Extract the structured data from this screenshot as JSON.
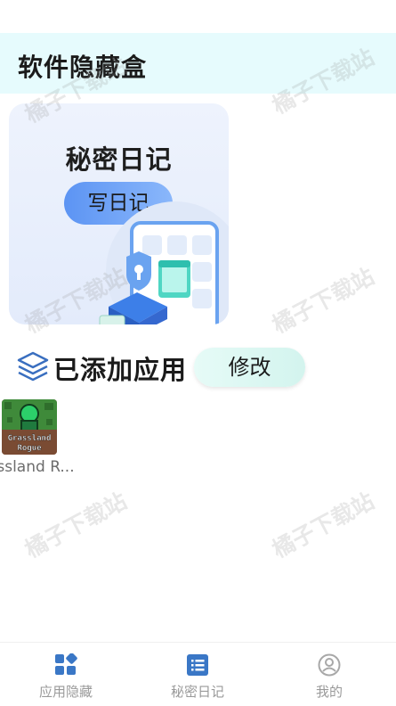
{
  "header": {
    "title": "软件隐藏盒"
  },
  "diary_card": {
    "title": "秘密日记",
    "button_label": "写日记"
  },
  "section": {
    "title": "已添加应用",
    "edit_label": "修改"
  },
  "apps": [
    {
      "name": "ssland R...",
      "icon_text_line1": "Grassland",
      "icon_text_line2": "Rogue"
    }
  ],
  "watermark": "橘子下载站",
  "bottom_nav": [
    {
      "label": "应用隐藏",
      "icon": "app-grid-icon"
    },
    {
      "label": "秘密日记",
      "icon": "list-icon"
    },
    {
      "label": "我的",
      "icon": "user-circle-icon"
    }
  ],
  "colors": {
    "accent": "#3a77c6",
    "header_bg": "#e6fbfd",
    "edit_bg": "#d3f4ee"
  }
}
